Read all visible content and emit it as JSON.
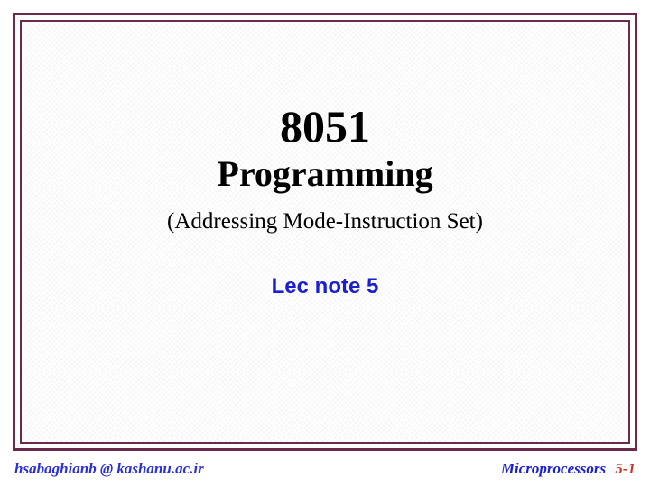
{
  "title": {
    "line1": "8051",
    "line2": "Programming"
  },
  "subtitle": "(Addressing Mode-Instruction Set)",
  "lecture_note": "Lec note 5",
  "footer": {
    "left": "hsabaghianb @ kashanu.ac.ir",
    "course": "Microprocessors",
    "page": "5-1"
  }
}
